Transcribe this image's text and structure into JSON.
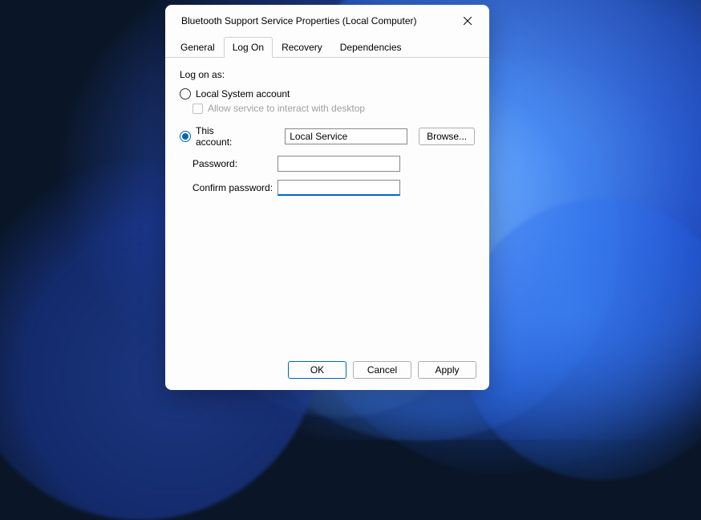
{
  "window": {
    "title": "Bluetooth Support Service Properties (Local Computer)"
  },
  "tabs": {
    "general": "General",
    "logon": "Log On",
    "recovery": "Recovery",
    "dependencies": "Dependencies",
    "active": "logon"
  },
  "logon": {
    "section_label": "Log on as:",
    "local_system_label": "Local System account",
    "allow_interact_label": "Allow service to interact with desktop",
    "this_account_label": "This account:",
    "account_value": "Local Service",
    "browse_label": "Browse...",
    "password_label": "Password:",
    "password_value": "",
    "confirm_label": "Confirm password:",
    "confirm_value": "",
    "selected": "this_account"
  },
  "footer": {
    "ok": "OK",
    "cancel": "Cancel",
    "apply": "Apply"
  }
}
